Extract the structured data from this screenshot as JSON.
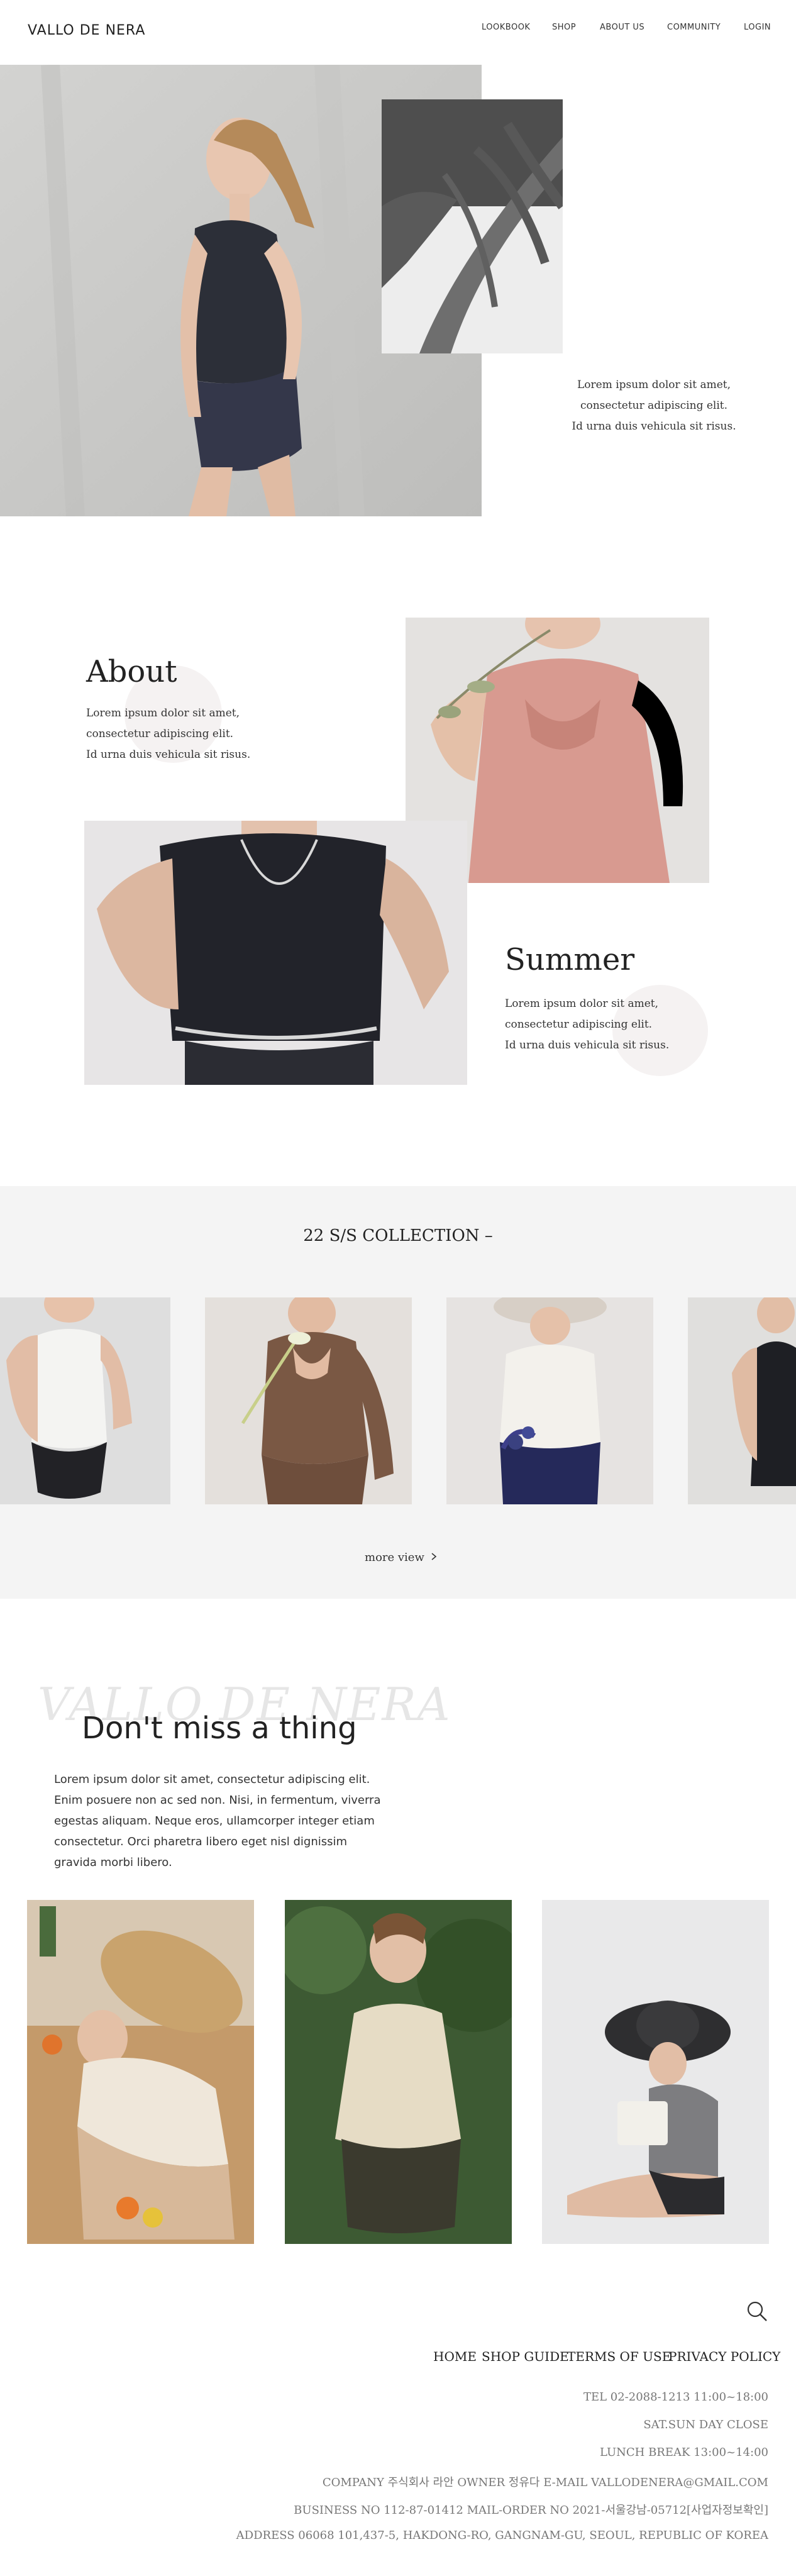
{
  "header": {
    "logo": "VALLO DE NERA",
    "nav": [
      "LOOKBOOK",
      "SHOP",
      "ABOUT US",
      "COMMUNITY",
      "LOGIN"
    ]
  },
  "hero": {
    "text": [
      "Lorem ipsum dolor sit amet,",
      "consectetur adipiscing elit.",
      "Id urna duis vehicula sit risus."
    ]
  },
  "about": {
    "title": "About",
    "text": [
      "Lorem ipsum dolor sit amet,",
      "consectetur adipiscing elit.",
      "Id urna duis vehicula sit risus."
    ]
  },
  "summer": {
    "title": "Summer",
    "text": [
      "Lorem ipsum dolor sit amet,",
      "consectetur adipiscing elit.",
      "Id urna duis vehicula sit risus."
    ]
  },
  "collection": {
    "title": "22 S/S COLLECTION –",
    "more_view": "more view"
  },
  "dont_miss": {
    "watermark": "VALLO DE NERA",
    "title": "Don't miss a thing",
    "text": [
      "Lorem ipsum dolor sit amet, consectetur adipiscing elit.",
      "Enim posuere non ac sed non. Nisi, in fermentum, viverra",
      "egestas aliquam. Neque eros, ullamcorper integer etiam",
      "consectetur. Orci pharetra libero eget nisl dignissim",
      "gravida morbi libero."
    ]
  },
  "footer": {
    "links": [
      "HOME",
      "SHOP GUIDE",
      "TERMS OF USE",
      "PRIVACY POLICY"
    ],
    "lines": [
      "TEL 02-2088-1213     11:00~18:00",
      "SAT.SUN DAY CLOSE",
      "LUNCH BREAK 13:00~14:00",
      "COMPANY 주식회사 라안 OWNER 정유다 E-MAIL VALLODENERA@GMAIL.COM",
      "BUSINESS NO 112-87-01412 MAIL-ORDER NO 2021-서울강남-05712[사업자정보확인]",
      "ADDRESS 06068 101,437-5, HAKDONG-RO, GANGNAM-GU, SEOUL, REPUBLIC OF KOREA"
    ]
  },
  "icons": {
    "search": "search-icon",
    "chevron": "chevron-right-icon"
  }
}
